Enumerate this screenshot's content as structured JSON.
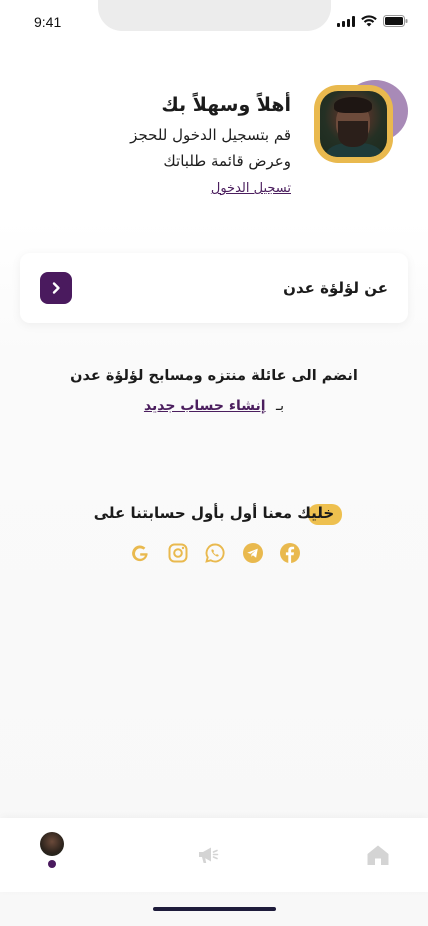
{
  "status_bar": {
    "time": "9:41"
  },
  "header": {
    "greeting": "أهلاً وسهلاً بك",
    "line1": "قم بتسجيل الدخول للحجز",
    "line2": "وعرض قائمة طلباتك",
    "login_link": "تسجيل الدخول"
  },
  "about": {
    "label": "عن لؤلؤة عدن"
  },
  "join": {
    "text": "انضم الى عائلة منتزه ومسابح لؤلؤة عدن",
    "prefix": "بـ",
    "link": "إنشاء حساب جديد"
  },
  "social": {
    "title": "خليك معنا أول بأول حسابتنا على",
    "icons": [
      "google-icon",
      "instagram-icon",
      "whatsapp-icon",
      "telegram-icon",
      "facebook-icon"
    ],
    "icon_color": "#e9b94e"
  },
  "bottom_nav": {
    "items": [
      "profile",
      "announcements",
      "home"
    ],
    "active": "profile"
  },
  "colors": {
    "brand_purple": "#4a1a5e",
    "accent_gold": "#e9b94e",
    "avatar_blob": "#a88ab7"
  }
}
